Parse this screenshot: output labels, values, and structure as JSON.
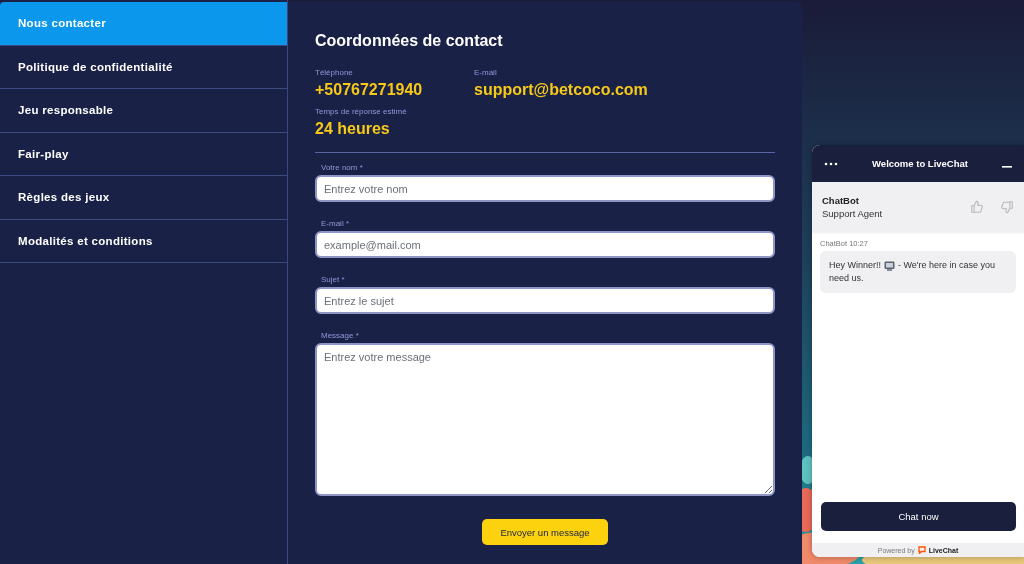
{
  "sidebar": {
    "items": [
      {
        "label": "Nous contacter",
        "selected": true
      },
      {
        "label": "Politique de confidentialité",
        "selected": false
      },
      {
        "label": "Jeu responsable",
        "selected": false
      },
      {
        "label": "Fair-play",
        "selected": false
      },
      {
        "label": "Règles des jeux",
        "selected": false
      },
      {
        "label": "Modalités et conditions",
        "selected": false
      }
    ]
  },
  "contact": {
    "title": "Coordonnées de contact",
    "details": [
      {
        "label": "Téléphone",
        "value": "+50767271940"
      },
      {
        "label": "E-mail",
        "value": "support@betcoco.com"
      },
      {
        "label": "Temps de réponse estimé",
        "value": "24 heures"
      }
    ],
    "fields": [
      {
        "kind": "input",
        "label": "Votre nom *",
        "placeholder": "Entrez votre nom"
      },
      {
        "kind": "input",
        "label": "E-mail *",
        "placeholder": "example@mail.com"
      },
      {
        "kind": "input",
        "label": "Sujet *",
        "placeholder": "Entrez le sujet"
      },
      {
        "kind": "textarea",
        "label": "Message *",
        "placeholder": "Entrez votre message"
      }
    ],
    "submit": "Envoyer un message"
  },
  "chat_widget": {
    "title": "Welcome to LiveChat",
    "agent_name": "ChatBot",
    "agent_role": "Support Agent",
    "message_meta": "ChatBot 10:27",
    "message_start": "Hey Winner!!",
    "message_end": "- We're here in case you",
    "message_tail": "need us.",
    "button": "Chat now",
    "powered_by": "Powered by",
    "brand": "LiveChat"
  }
}
